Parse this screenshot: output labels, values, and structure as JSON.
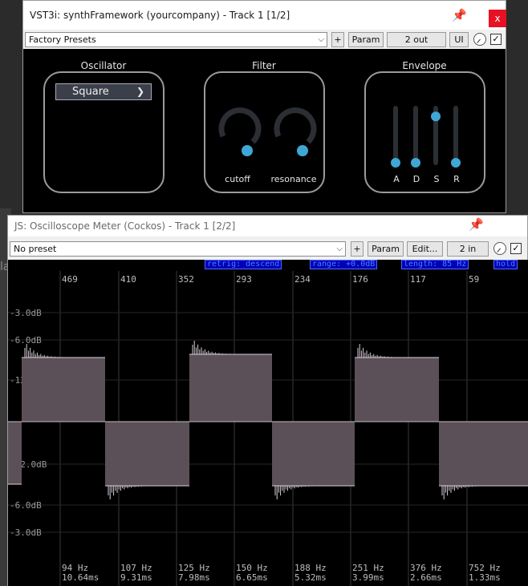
{
  "background": {
    "partial_text": "la"
  },
  "synth_window": {
    "title": "VST3i: synthFramework (yourcompany) - Track 1 [1/2]",
    "close_label": "x",
    "preset": "Factory Presets",
    "plus_label": "+",
    "param_label": "Param",
    "io_label": "2 out",
    "ui_label": "UI",
    "bypass_checked": "✓",
    "sections": {
      "oscillator": {
        "title": "Oscillator",
        "waveform": "Square"
      },
      "filter": {
        "title": "Filter",
        "cutoff_label": "cutoff",
        "resonance_label": "resonance"
      },
      "envelope": {
        "title": "Envelope",
        "sliders": [
          {
            "label": "A",
            "level": 0.0
          },
          {
            "label": "D",
            "level": 0.0
          },
          {
            "label": "S",
            "level": 0.85
          },
          {
            "label": "R",
            "level": 0.0
          }
        ]
      }
    },
    "colors": {
      "accent": "#3fa7d6",
      "panel_border": "#9b9b9b"
    }
  },
  "scope_window": {
    "title": "JS: Oscilloscope Meter (Cockos) - Track 1 [2/2]",
    "preset": "No preset",
    "plus_label": "+",
    "param_label": "Param",
    "edit_label": "Edit...",
    "io_label": "2 in",
    "bypass_checked": "✓",
    "status": {
      "retrig": "retrig: descend",
      "range": "range: +0.0dB",
      "length": "length: 85 Hz",
      "hold": "hold"
    },
    "top_labels": [
      "469",
      "410",
      "352",
      "293",
      "234",
      "176",
      "117",
      "59"
    ],
    "db_labels_upper": [
      "-3.0dB",
      "-6.0dB",
      "-12.0dB"
    ],
    "db_labels_lower": [
      "-12.0dB",
      "-6.0dB",
      "-3.0dB"
    ],
    "bottom_hz": [
      "94 Hz",
      "107 Hz",
      "125 Hz",
      "150 Hz",
      "188 Hz",
      "251 Hz",
      "376 Hz",
      "752 Hz"
    ],
    "bottom_ms": [
      "10.64ms",
      "9.31ms",
      "7.98ms",
      "6.65ms",
      "5.32ms",
      "3.99ms",
      "2.66ms",
      "1.33ms"
    ],
    "colors": {
      "wave_fill": "#5c5058",
      "wave_line": "#d8d0d8",
      "grid": "#2a2a2a",
      "status_text": "#4f7dff"
    }
  }
}
